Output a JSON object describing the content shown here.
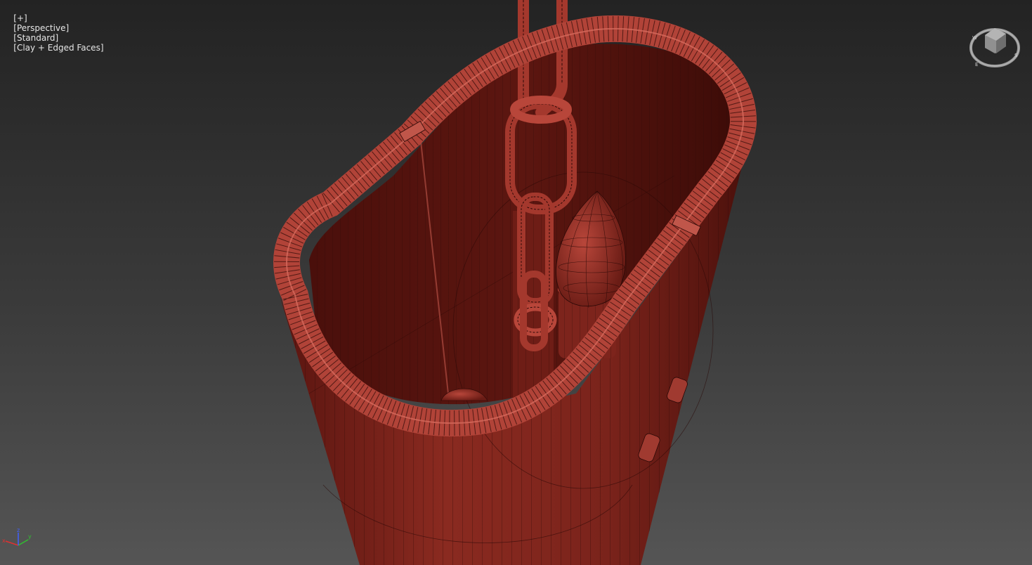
{
  "viewport": {
    "labels": {
      "plus_menu": "[+]",
      "point_of_view": "[Perspective]",
      "shading_mode": "[Standard]",
      "display_mode": "[Clay + Edged Faces]"
    },
    "viewcube": {
      "face_label": "",
      "compass_marks": [
        "N",
        "E",
        "S",
        "W"
      ]
    },
    "axis_tripod": {
      "x_label": "x",
      "y_label": "y",
      "z_label": "z"
    }
  },
  "colors": {
    "background_top": "#232323",
    "background_bottom": "#555555",
    "clay_red": "#8e2a20",
    "clay_dark": "#4a0f0b",
    "rim_light": "#c0564a",
    "wire_edge": "#2a0806",
    "label_text": "#e6e6e6",
    "axis_x": "#e03030",
    "axis_y": "#30c030",
    "axis_z": "#4060ff"
  }
}
